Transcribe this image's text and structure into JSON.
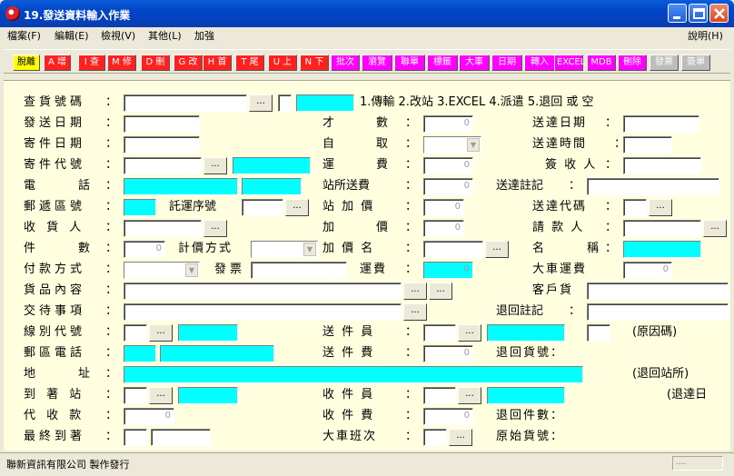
{
  "window": {
    "title": "19.發送資料輸入作業"
  },
  "menu": {
    "file": "檔案(F)",
    "edit": "編輯(E)",
    "view": "檢視(V)",
    "other": "其他(L)",
    "enhance": "加強",
    "help": "說明(H)"
  },
  "toolbar": [
    "脫離",
    "A 增",
    "I 查",
    "M 修",
    "D 刪",
    "G 改",
    "H 首",
    "T 尾",
    "U 上",
    "N 下",
    "批次",
    "瀏覽",
    "聯單",
    "標籤",
    "大車",
    "日期",
    "轉入",
    "EXCEL",
    "MDB",
    "刪除",
    "發票",
    "簽單"
  ],
  "form": {
    "query_no": "查貨號碼",
    "query_colon": "：",
    "mode_options": "1.傳輸 2.改站 3.EXCEL 4.派遣 5.退回 或 空",
    "send_date": "發送日期",
    "cai": "才",
    "cai2": "數",
    "deliver_date": "送達日期",
    "mail_date": "寄件日期",
    "self": "自",
    "self2": "取",
    "deliver_time": "送達時間",
    "sender_code": "寄件代號",
    "freight": "運",
    "freight2": "費",
    "signer": "簽 收 人",
    "phone": "電",
    "phone2": "話",
    "station_fee": "站所送費",
    "deliver_note": "送達註記",
    "zip": "郵遞區號",
    "consign_seq": "託運序號",
    "station_add": "站 加 價",
    "deliver_code": "送達代碼",
    "receiver": "收 貨 人",
    "add": "加",
    "add2": "價",
    "claimant": "請 款 人",
    "pieces": "件",
    "pieces2": "數",
    "pricing": "計價方式",
    "add_name": "加 價 名",
    "name": "名",
    "name2": "稱",
    "payment": "付款方式",
    "invoice": "發票",
    "fee_label": "運費",
    "truck_fee": "大車運費",
    "goods": "貨品內容",
    "customer_goods": "客戶貨",
    "instructions": "交待事項",
    "return_note": "退回註記",
    "route_code": "線別代號",
    "courier": "送 件 員",
    "reason": "(原因碼)",
    "zip_phone": "郵區電話",
    "delivery_fee": "送 件 費",
    "return_goods": "退回貨號：",
    "address": "地",
    "address2": "址",
    "return_station": "(退回站所)",
    "arrival": "到 著 站",
    "collector": "收 件 員",
    "return_deliver": "(退達日",
    "cod": "代 收 款",
    "collect_fee": "收 件 費",
    "return_count": "退回件數：",
    "final": "最終到著",
    "truck_shift": "大車班次",
    "orig_no": "原始貨號："
  },
  "zero": "0",
  "ellipsis": "...",
  "status": {
    "text": "聯新資訊有限公司 製作發行",
    "right": "...."
  }
}
